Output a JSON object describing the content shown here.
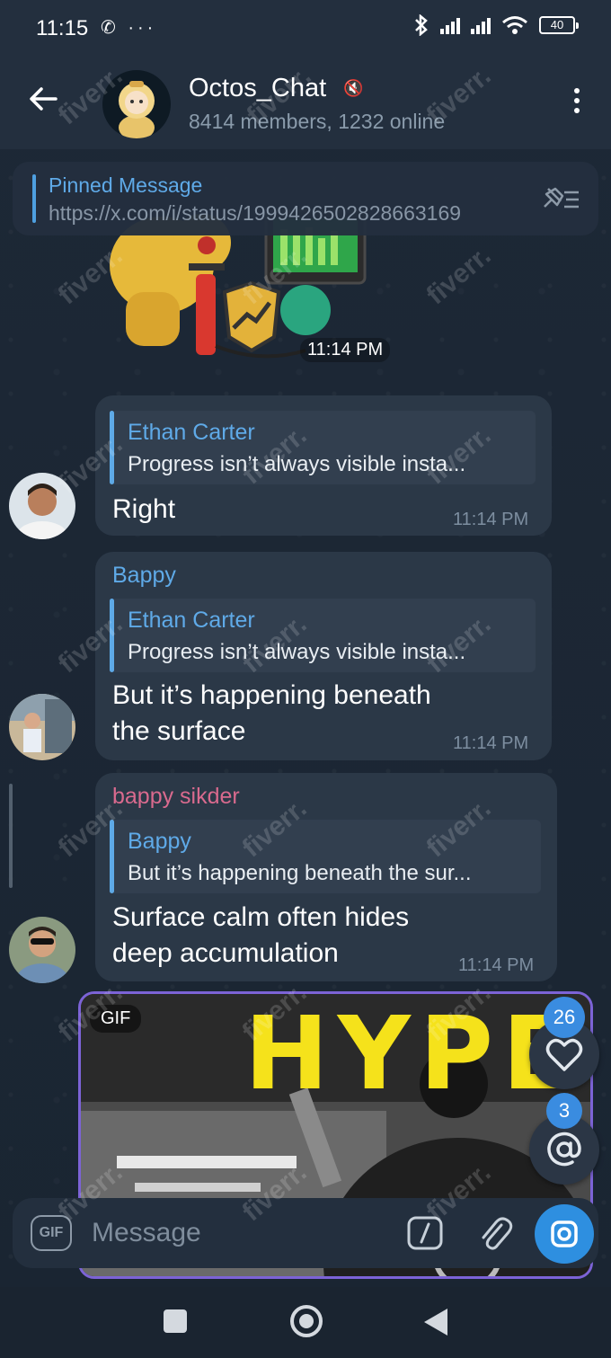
{
  "status_bar": {
    "time": "11:15",
    "left_icons": "✆ ···",
    "battery": "40"
  },
  "header": {
    "title": "Octos_Chat",
    "subtitle": "8414 members, 1232 online"
  },
  "pinned": {
    "title": "Pinned Message",
    "text": "https://x.com/i/status/1999426502828663169"
  },
  "sticker": {
    "time": "11:14 PM"
  },
  "messages": [
    {
      "sender": "",
      "reply_name": "Ethan Carter",
      "reply_text": "Progress isn’t always visible insta...",
      "text": "Right",
      "time": "11:14 PM"
    },
    {
      "sender": "Bappy",
      "sender_color": "#5faae8",
      "reply_name": "Ethan Carter",
      "reply_text": "Progress isn’t always visible insta...",
      "text_lines": [
        "But it’s happening beneath",
        "the surface"
      ],
      "time": "11:14 PM"
    },
    {
      "sender": "bappy sikder",
      "sender_color": "#d96a8e",
      "reply_name": "Bappy",
      "reply_text": "But it’s happening beneath the sur...",
      "text_lines": [
        "Surface calm often hides",
        "deep accumulation"
      ],
      "time": "11:14 PM"
    }
  ],
  "gif": {
    "badge": "GIF",
    "caption_text": "HYPE"
  },
  "fabs": {
    "reactions_count": "26",
    "mentions_count": "3"
  },
  "composer": {
    "gif_label": "GIF",
    "placeholder": "Message"
  },
  "watermark": "fiverr."
}
